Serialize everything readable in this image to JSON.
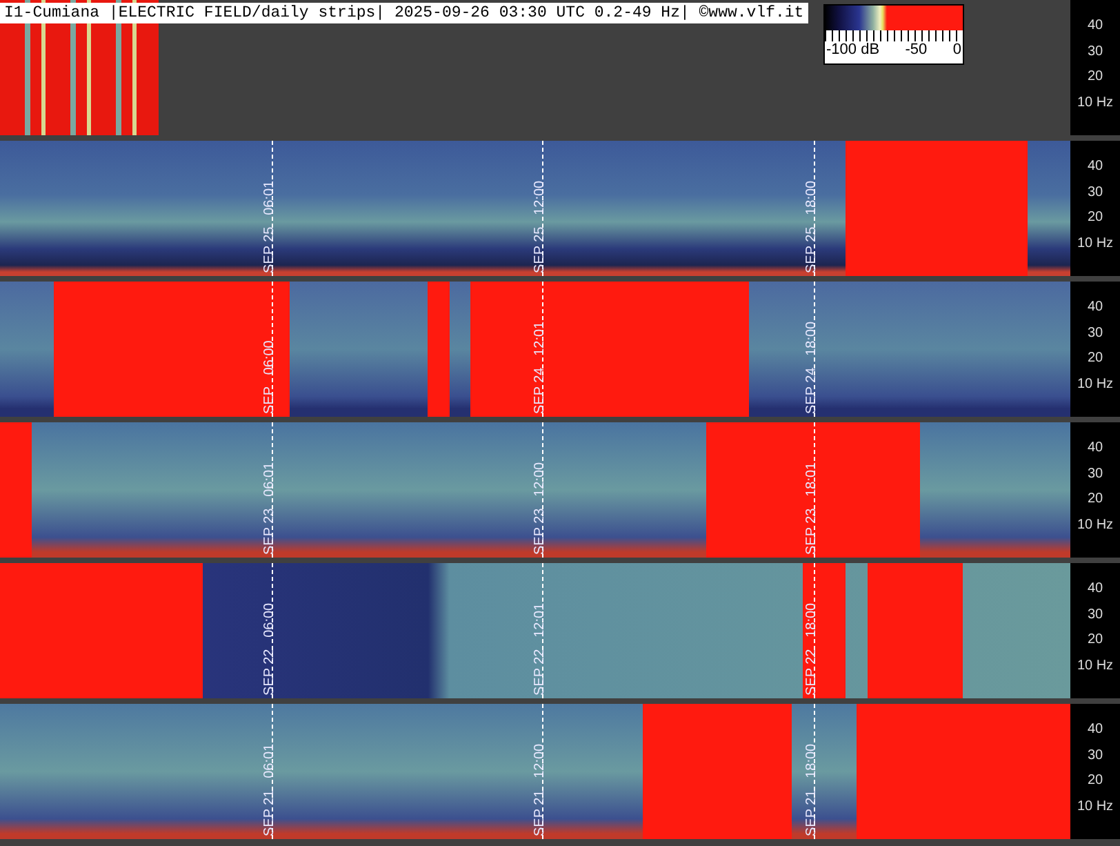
{
  "title": "I1-Cumiana |ELECTRIC FIELD/daily strips| 2025-09-26 03:30 UTC 0.2-49 Hz| ©www.vlf.it",
  "colorbar": {
    "labels": [
      "-100 dB",
      "-50",
      "0"
    ]
  },
  "strips": [
    {
      "axis_labels": [
        "40",
        "30",
        "20",
        "10 Hz"
      ]
    },
    {
      "axis_labels": [
        "40",
        "30",
        "20",
        "10 Hz"
      ],
      "markers": [
        {
          "date": "SEP 25",
          "time": "06:01"
        },
        {
          "date": "SEP 25",
          "time": "12:00"
        },
        {
          "date": "SEP 25",
          "time": "18:00"
        }
      ]
    },
    {
      "axis_labels": [
        "40",
        "30",
        "20",
        "10 Hz"
      ],
      "markers": [
        {
          "date": "SEP",
          "time": "06:00"
        },
        {
          "date": "SEP 24",
          "time": "12:01"
        },
        {
          "date": "SEP 24",
          "time": "18:00"
        }
      ]
    },
    {
      "axis_labels": [
        "40",
        "30",
        "20",
        "10 Hz"
      ],
      "markers": [
        {
          "date": "SEP 23",
          "time": "06:01"
        },
        {
          "date": "SEP 23",
          "time": "12:00"
        },
        {
          "date": "SEP 23",
          "time": "18:01"
        }
      ]
    },
    {
      "axis_labels": [
        "40",
        "30",
        "20",
        "10 Hz"
      ],
      "markers": [
        {
          "date": "SEP 22",
          "time": "06:00"
        },
        {
          "date": "SEP 22",
          "time": "12:01"
        },
        {
          "date": "SEP 22",
          "time": "18:00"
        }
      ]
    },
    {
      "axis_labels": [
        "40",
        "30",
        "20",
        "10 Hz"
      ],
      "markers": [
        {
          "date": "SEP 21",
          "time": "06:01"
        },
        {
          "date": "SEP 21",
          "time": "12:00"
        },
        {
          "date": "SEP 21",
          "time": "18:00"
        }
      ]
    }
  ]
}
